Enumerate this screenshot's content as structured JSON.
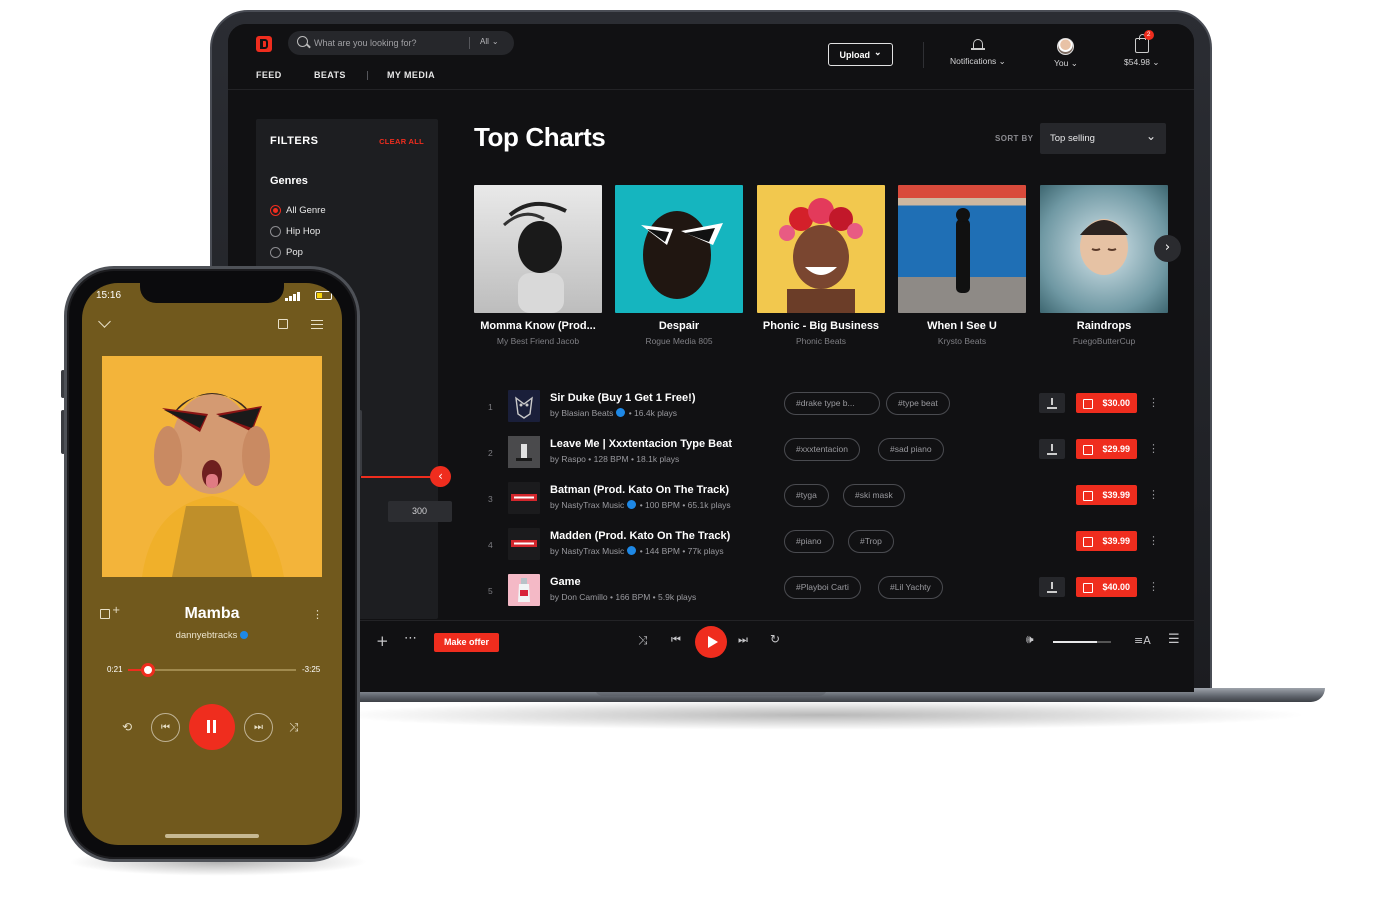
{
  "colors": {
    "accent": "#ef2d1e",
    "screen_bg": "#111113",
    "panel_bg": "#1d1e21",
    "phone_bg": "#71591d",
    "verified": "#1e88e5"
  },
  "header": {
    "search_placeholder": "What are you looking for?",
    "search_scope": "All",
    "nav": [
      "FEED",
      "BEATS",
      "MY MEDIA"
    ],
    "upload_label": "Upload",
    "notifications_label": "Notifications",
    "profile_label": "You",
    "cart_total": "$54.98",
    "cart_count": "2"
  },
  "filters": {
    "title": "FILTERS",
    "clear_label": "CLEAR ALL",
    "genres_heading": "Genres",
    "genres": [
      {
        "label": "All Genre",
        "selected": true
      },
      {
        "label": "Hip Hop",
        "selected": false
      },
      {
        "label": "Pop",
        "selected": false
      }
    ],
    "price_value": "300"
  },
  "main": {
    "title": "Top Charts",
    "sort_label": "SORT BY",
    "sort_value": "Top selling",
    "cards": [
      {
        "title": "Momma Know (Prod...",
        "subtitle": "My Best Friend Jacob"
      },
      {
        "title": "Despair",
        "subtitle": "Rogue Media 805"
      },
      {
        "title": "Phonic - Big Business",
        "subtitle": "Phonic Beats"
      },
      {
        "title": "When I See U",
        "subtitle": "Krysto Beats"
      },
      {
        "title": "Raindrops",
        "subtitle": "FuegoButterCup"
      }
    ],
    "tracks": [
      {
        "num": "1",
        "title": "Sir Duke (Buy 1 Get 1 Free!)",
        "by": "by Blasian Beats",
        "meta": "• 16.4k plays",
        "verified": true,
        "tags": [
          "#drake type b...",
          "#type beat"
        ],
        "download": true,
        "price": "$30.00"
      },
      {
        "num": "2",
        "title": "Leave Me | Xxxtentacion Type Beat",
        "by": "by Raspo",
        "meta": "• 128 BPM • 18.1k plays",
        "verified": false,
        "tags": [
          "#xxxtentacion",
          "#sad piano"
        ],
        "download": true,
        "price": "$29.99"
      },
      {
        "num": "3",
        "title": "Batman (Prod. Kato On The Track)",
        "by": "by NastyTrax Music",
        "meta": "• 100 BPM • 65.1k plays",
        "verified": true,
        "tags": [
          "#tyga",
          "#ski mask"
        ],
        "download": false,
        "price": "$39.99"
      },
      {
        "num": "4",
        "title": "Madden (Prod. Kato On The Track)",
        "by": "by NastyTrax Music",
        "meta": "• 144 BPM • 77k plays",
        "verified": true,
        "tags": [
          "#piano",
          "#Trop"
        ],
        "download": false,
        "price": "$39.99"
      },
      {
        "num": "5",
        "title": "Game",
        "by": "by Don Camillo",
        "meta": "• 166 BPM • 5.9k plays",
        "verified": false,
        "tags": [
          "#Playboi Carti",
          "#Lil Yachty"
        ],
        "download": true,
        "price": "$40.00"
      }
    ]
  },
  "player": {
    "make_offer_label": "Make offer",
    "volume_level": 0.75
  },
  "phone": {
    "time": "15:16",
    "title": "Mamba",
    "artist": "dannyebtracks",
    "current_time": "0:21",
    "remaining_time": "-3:25",
    "progress": 0.12
  },
  "icons": [
    "search-icon",
    "chevron-down-icon",
    "bell-icon",
    "cart-icon",
    "avatar",
    "chevron-right-icon",
    "chevron-left-icon",
    "download-icon",
    "add-to-cart-icon",
    "kebab-icon",
    "plus-icon",
    "more-icon",
    "shuffle-icon",
    "previous-icon",
    "play-icon",
    "next-icon",
    "repeat-icon",
    "volume-icon",
    "lyrics-icon",
    "queue-icon",
    "pause-icon",
    "edit-icon",
    "verified-icon"
  ]
}
